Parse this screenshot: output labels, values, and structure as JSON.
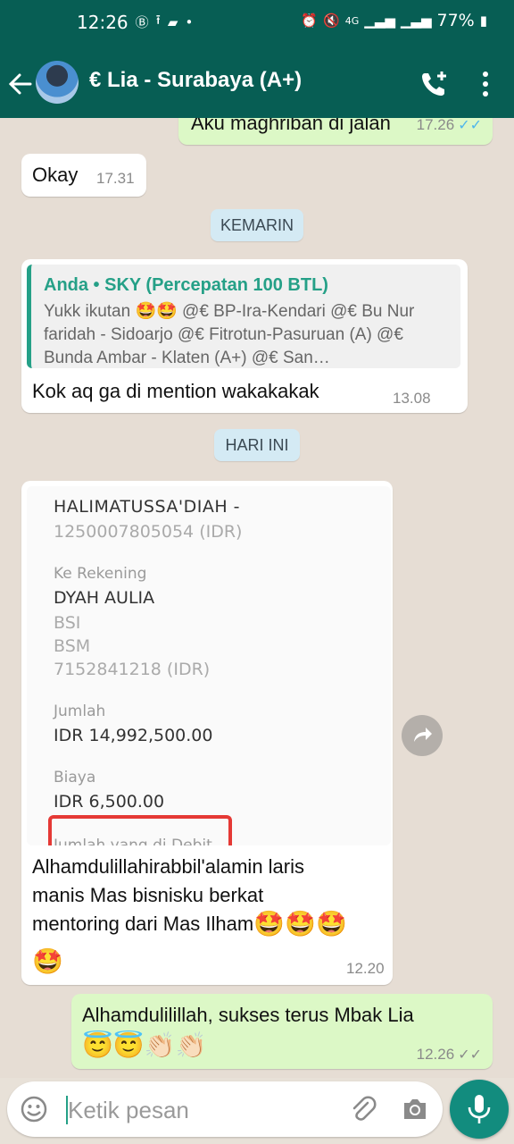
{
  "status_bar": {
    "time": "12:26",
    "left_icons": [
      "b-circle-icon",
      "upload-icon",
      "chat-icon",
      "dot-icon"
    ],
    "right_icons": [
      "alarm-icon",
      "mute-icon",
      "4g-icon",
      "signal-icon",
      "signal-icon"
    ],
    "battery": "77%"
  },
  "header": {
    "title": "€ Lia - Surabaya (A+)",
    "icons": [
      "back-arrow-icon",
      "avatar",
      "add-call-icon",
      "more-vert-icon"
    ]
  },
  "messages": {
    "m1": {
      "text": "Aku maghriban di jalan",
      "time": "17.26",
      "status": "read"
    },
    "m2": {
      "text": "Okay",
      "time": "17.31"
    },
    "date1": "KEMARIN",
    "m3": {
      "quote_author": "Anda • SKY (Percepatan 100 BTL)",
      "quote_text": "Yukk ikutan 🤩🤩 @€ BP-Ira-Kendari @€ Bu Nur faridah - Sidoarjo @€ Fitrotun-Pasuruan (A) @€ Bunda Ambar - Klaten (A+) @€ San…",
      "text": "Kok aq ga di mention wakakakak",
      "time": "13.08"
    },
    "date2": "HARI INI",
    "m4": {
      "receipt": {
        "sender_name": "HALIMATUSSA'DIAH -",
        "sender_account": "1250007805054 (IDR)",
        "to_label": "Ke Rekening",
        "to_name": "DYAH AULIA",
        "bank1": "BSI",
        "bank2": "BSM",
        "to_account": "7152841218 (IDR)",
        "amount_label": "Jumlah",
        "amount": "IDR 14,992,500.00",
        "fee_label": "Biaya",
        "fee": "IDR 6,500.00",
        "debit_label": "Jumlah yang di Debit"
      },
      "text_line1": "Alhamdulillahirabbil'alamin laris",
      "text_line2": "manis Mas bisnisku berkat",
      "text_line3": "mentoring dari Mas Ilham",
      "emoji_line3": "🤩🤩🤩",
      "emoji_line4": "🤩",
      "time": "12.20"
    },
    "m5": {
      "text": "Alhamdulilillah, sukses terus Mbak Lia",
      "emoji": "😇😇👏🏻👏🏻",
      "time": "12.26",
      "status": "delivered"
    }
  },
  "input": {
    "placeholder": "Ketik pesan",
    "icons": [
      "emoji-icon",
      "attach-icon",
      "camera-icon",
      "mic-icon"
    ]
  },
  "colors": {
    "header": "#075e54",
    "outgoing_bubble": "#dcf8c6",
    "incoming_bubble": "#ffffff",
    "accent": "#25a087",
    "read_ticks": "#4fb6ec"
  }
}
